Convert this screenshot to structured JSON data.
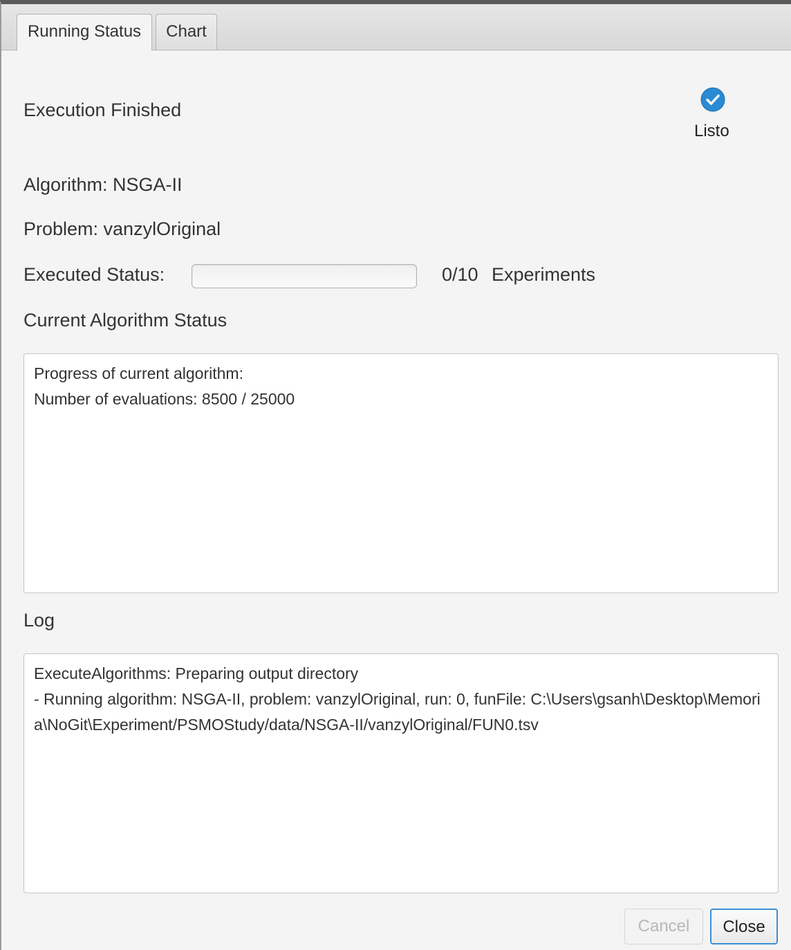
{
  "tabs": [
    {
      "label": "Running Status",
      "selected": true
    },
    {
      "label": "Chart",
      "selected": false
    }
  ],
  "header": {
    "status_text": "Execution Finished",
    "ready_icon": "check-circle-icon",
    "ready_label": "Listo"
  },
  "fields": {
    "algorithm": "Algorithm:  NSGA-II",
    "problem": "Problem:  vanzylOriginal",
    "executed_status_label": "Executed Status:",
    "experiments_count": "0/10",
    "experiments_label": "Experiments",
    "progress_fraction": 0
  },
  "current_status": {
    "title": "Current Algorithm Status",
    "lines": [
      "Progress of current algorithm:",
      "Number of evaluations: 8500 / 25000"
    ]
  },
  "log": {
    "title": "Log",
    "lines": [
      "ExecuteAlgorithms: Preparing output directory",
      "- Running algorithm: NSGA-II, problem: vanzylOriginal, run: 0, funFile: C:\\Users\\gsanh\\Desktop\\Memoria\\NoGit\\Experiment/PSMOStudy/data/NSGA-II/vanzylOriginal/FUN0.tsv"
    ]
  },
  "buttons": {
    "cancel": "Cancel",
    "close": "Close"
  },
  "colors": {
    "accent": "#3c8fd8",
    "check": "#2a8ad4"
  }
}
